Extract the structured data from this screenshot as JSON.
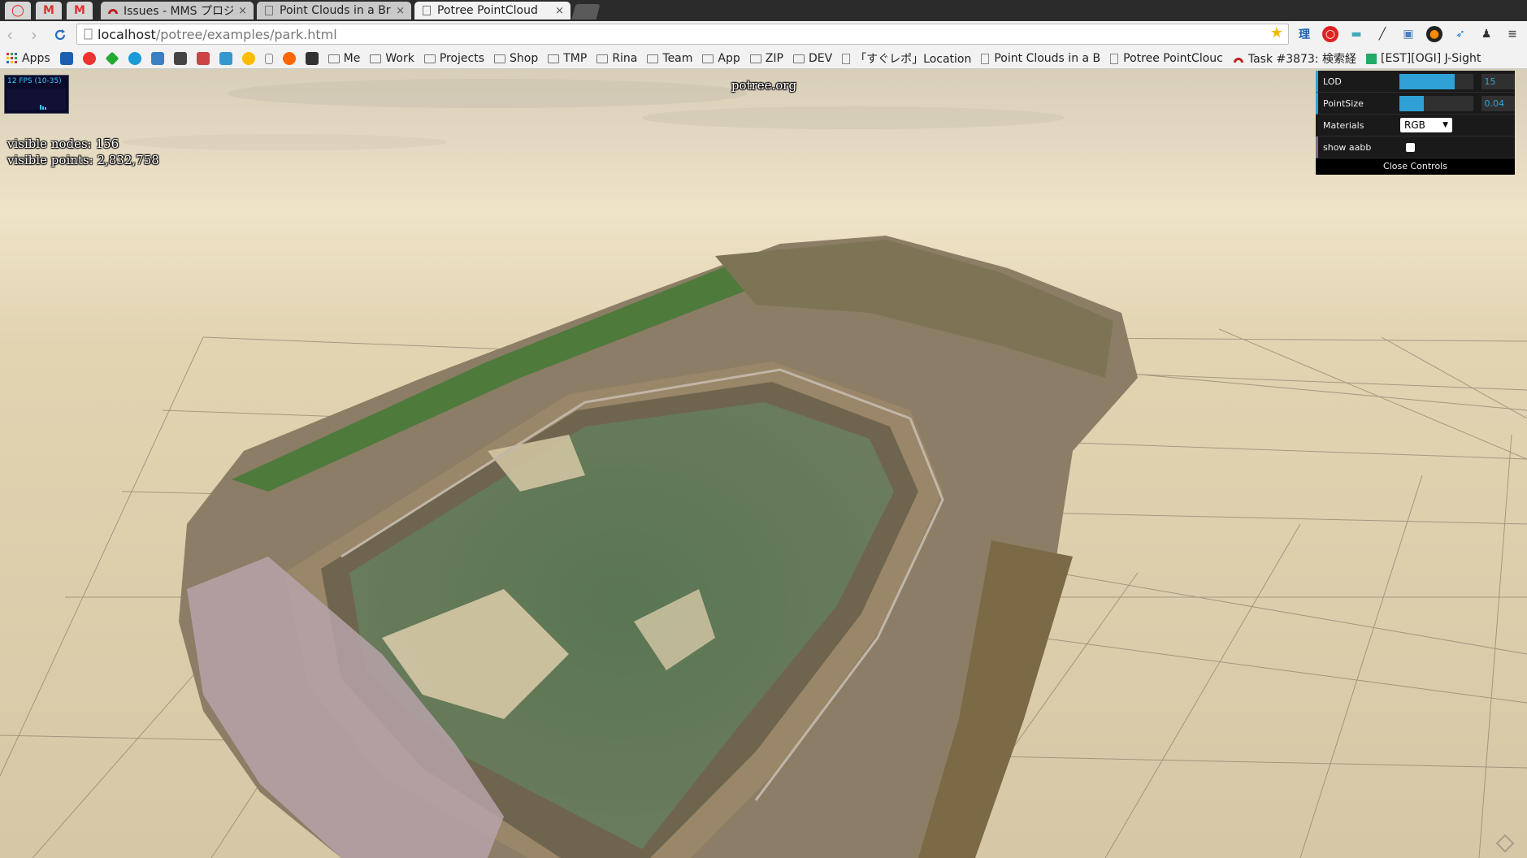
{
  "browser": {
    "tabs": [
      {
        "title": "Issues - MMS プロジェク",
        "active": false
      },
      {
        "title": "Point Clouds in a Brow",
        "active": false
      },
      {
        "title": "Potree PointCloud",
        "active": true
      }
    ],
    "close_glyph": "×",
    "url_host": "localhost",
    "url_path": "/potree/examples/park.html",
    "bookmarks": {
      "apps_label": "Apps",
      "folders": [
        "Me",
        "Work",
        "Projects",
        "Shop",
        "TMP",
        "Rina",
        "Team",
        "App",
        "ZIP",
        "DEV"
      ],
      "links": [
        "「すぐレポ」Location",
        "Point Clouds in a B",
        "Potree PointClouc",
        "Task #3873: 検索経",
        "[EST][OGI] J-Sight"
      ]
    }
  },
  "viewer": {
    "fps_label": "12 FPS (10-35)",
    "visible_nodes": "visible nodes: 156",
    "visible_points": "visible points: 2,832,758",
    "brand": "potree.org"
  },
  "gui": {
    "lod_label": "LOD",
    "lod_value": "15",
    "lod_fraction": 0.75,
    "pointsize_label": "PointSize",
    "pointsize_value": "0.04",
    "pointsize_fraction": 0.33,
    "materials_label": "Materials",
    "materials_value": "RGB",
    "show_aabb_label": "show aabb",
    "show_aabb_checked": false,
    "close_label": "Close Controls"
  },
  "colors": {
    "accent": "#2fa1d6",
    "ground": "#d9ccac",
    "sky": "#efe4cc"
  }
}
